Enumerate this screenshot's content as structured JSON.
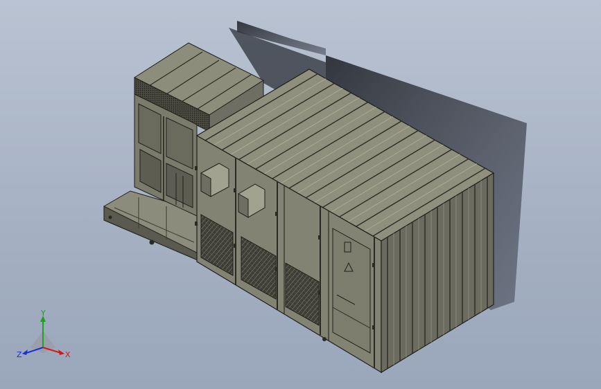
{
  "triad": {
    "x_label": "X",
    "y_label": "Y",
    "z_label": "Z",
    "colors": {
      "x": "#d01818",
      "y": "#20a020",
      "z": "#1830d0"
    }
  },
  "palette": {
    "background_top": "#b9c3d2",
    "background_bottom": "#9aa6ba",
    "body_light": "#9a9a86",
    "body_mid": "#77776a",
    "body_dark": "#4c4c44",
    "outline": "#1e1e1a",
    "shadow": "#33363f"
  }
}
